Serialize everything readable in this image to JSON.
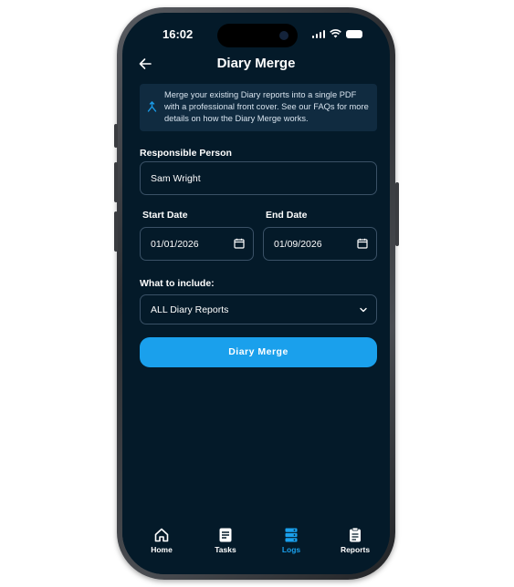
{
  "status_bar": {
    "time": "16:02"
  },
  "header": {
    "title": "Diary Merge"
  },
  "info": {
    "text": "Merge your existing Diary reports into a single PDF with a professional front cover. See our FAQs for more details on how the Diary Merge works."
  },
  "form": {
    "responsible_label": "Responsible Person",
    "responsible_value": "Sam Wright",
    "start_label": "Start Date",
    "start_value": "01/01/2026",
    "end_label": "End Date",
    "end_value": "01/09/2026",
    "include_label": "What to include:",
    "include_value": "ALL Diary Reports",
    "submit_label": "Diary Merge"
  },
  "tabs": [
    {
      "label": "Home",
      "icon": "home-icon",
      "active": false
    },
    {
      "label": "Tasks",
      "icon": "tasks-icon",
      "active": false
    },
    {
      "label": "Logs",
      "icon": "logs-icon",
      "active": true
    },
    {
      "label": "Reports",
      "icon": "reports-icon",
      "active": false
    }
  ],
  "colors": {
    "background": "#041a29",
    "accent": "#1aa0ec",
    "info_box": "#102b40"
  }
}
